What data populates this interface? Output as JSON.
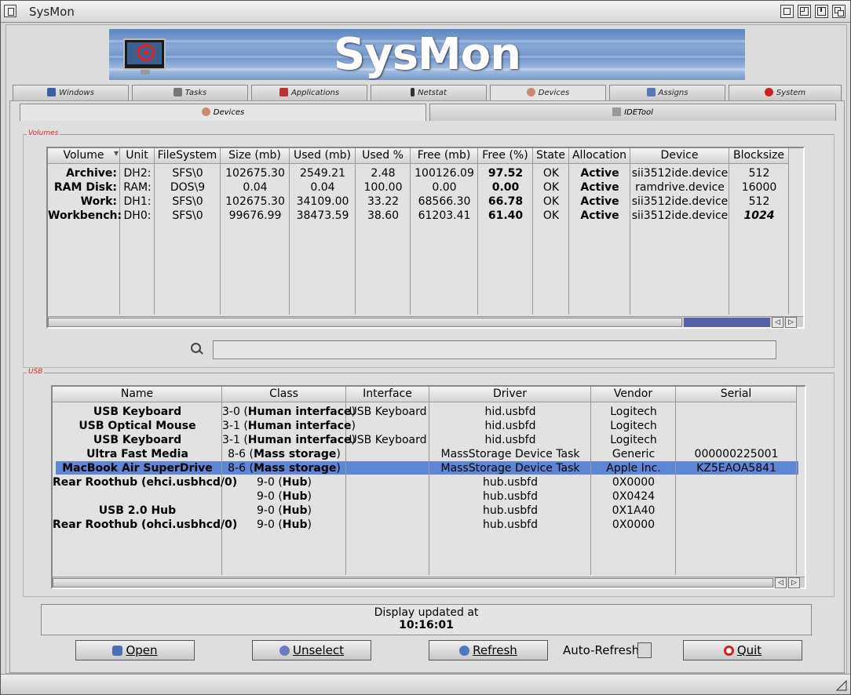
{
  "window": {
    "title": "SysMon"
  },
  "banner": {
    "logo_text": "SysMon"
  },
  "tabs": [
    {
      "label": "Windows",
      "icon": "windows-icon"
    },
    {
      "label": "Tasks",
      "icon": "tasks-icon"
    },
    {
      "label": "Applications",
      "icon": "applications-icon"
    },
    {
      "label": "Netstat",
      "icon": "netstat-icon"
    },
    {
      "label": "Devices",
      "icon": "devices-icon"
    },
    {
      "label": "Assigns",
      "icon": "assigns-icon"
    },
    {
      "label": "System",
      "icon": "system-icon"
    }
  ],
  "subtabs": [
    {
      "label": "Devices",
      "icon": "devices-icon"
    },
    {
      "label": "IDETool",
      "icon": "idetool-icon"
    }
  ],
  "volumes": {
    "group_label": "Volumes",
    "columns": [
      "Volume",
      "Unit",
      "FileSystem",
      "Size (mb)",
      "Used (mb)",
      "Used %",
      "Free (mb)",
      "Free (%)",
      "State",
      "Allocation",
      "Device",
      "Blocksize"
    ],
    "rows": [
      [
        "Archive:",
        "DH2:",
        "SFS\\0",
        "102675.30",
        "2549.21",
        "2.48",
        "100126.09",
        "97.52",
        "OK",
        "Active",
        "sii3512ide.device",
        "512"
      ],
      [
        "RAM Disk:",
        "RAM:",
        "DOS\\9",
        "0.04",
        "0.04",
        "100.00",
        "0.00",
        "0.00",
        "OK",
        "Active",
        "ramdrive.device",
        "16000"
      ],
      [
        "Work:",
        "DH1:",
        "SFS\\0",
        "102675.30",
        "34109.00",
        "33.22",
        "68566.30",
        "66.78",
        "OK",
        "Active",
        "sii3512ide.device",
        "512"
      ],
      [
        "Workbench:",
        "DH0:",
        "SFS\\0",
        "99676.99",
        "38473.59",
        "38.60",
        "61203.41",
        "61.40",
        "OK",
        "Active",
        "sii3512ide.device",
        "1024"
      ]
    ],
    "search_placeholder": ""
  },
  "usb": {
    "group_label": "USB",
    "columns": [
      "Name",
      "Class",
      "Interface",
      "Driver",
      "Vendor",
      "Serial"
    ],
    "rows": [
      {
        "name": "USB Keyboard",
        "class_code": "3-0",
        "class_name": "Human interface",
        "interface": "USB Keyboard",
        "driver": "hid.usbfd",
        "vendor": "Logitech",
        "serial": ""
      },
      {
        "name": "USB Optical Mouse",
        "class_code": "3-1",
        "class_name": "Human interface",
        "interface": "",
        "driver": "hid.usbfd",
        "vendor": "Logitech",
        "serial": ""
      },
      {
        "name": "USB Keyboard",
        "class_code": "3-1",
        "class_name": "Human interface",
        "interface": "USB Keyboard",
        "driver": "hid.usbfd",
        "vendor": "Logitech",
        "serial": ""
      },
      {
        "name": "Ultra Fast Media",
        "class_code": "8-6",
        "class_name": "Mass storage",
        "interface": "",
        "driver": "MassStorage Device Task",
        "vendor": "Generic",
        "serial": "000000225001"
      },
      {
        "name": "MacBook Air SuperDrive",
        "class_code": "8-6",
        "class_name": "Mass storage",
        "interface": "",
        "driver": "MassStorage Device Task",
        "vendor": "Apple Inc.",
        "serial": "KZ5EAOA5841"
      },
      {
        "name": "Rear Roothub (ehci.usbhcd/0)",
        "class_code": "9-0",
        "class_name": "Hub",
        "interface": "",
        "driver": "hub.usbfd",
        "vendor": "0X0000",
        "serial": ""
      },
      {
        "name": "",
        "class_code": "9-0",
        "class_name": "Hub",
        "interface": "",
        "driver": "hub.usbfd",
        "vendor": "0X0424",
        "serial": ""
      },
      {
        "name": "USB 2.0 Hub",
        "class_code": "9-0",
        "class_name": "Hub",
        "interface": "",
        "driver": "hub.usbfd",
        "vendor": "0X1A40",
        "serial": ""
      },
      {
        "name": "Rear Roothub (ohci.usbhcd/0)",
        "class_code": "9-0",
        "class_name": "Hub",
        "interface": "",
        "driver": "hub.usbfd",
        "vendor": "0X0000",
        "serial": ""
      }
    ],
    "selected_row": 4
  },
  "status": {
    "line1": "Display updated at",
    "time": "10:16:01"
  },
  "buttons": {
    "open": {
      "label": "Open",
      "icon": "open-icon"
    },
    "unselect": {
      "label": "Unselect",
      "icon": "unselect-icon"
    },
    "refresh": {
      "label": "Refresh",
      "icon": "refresh-icon"
    },
    "auto_refresh": {
      "label": "Auto-Refresh",
      "checked": false
    },
    "quit": {
      "label": "Quit",
      "icon": "quit-icon"
    }
  },
  "colors": {
    "selection": "#5f86d4",
    "group_label": "#dd2222",
    "scrollbar_thumb": "#5562a8"
  }
}
